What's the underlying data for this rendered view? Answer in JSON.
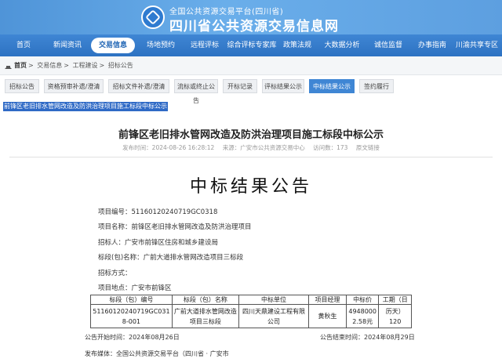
{
  "header": {
    "subtitle": "全国公共资源交易平台(四川省)",
    "title": "四川省公共资源交易信息网"
  },
  "nav": [
    {
      "label": "首页"
    },
    {
      "label": "新闻资讯"
    },
    {
      "label": "交易信息",
      "active": true
    },
    {
      "label": "场地预约"
    },
    {
      "label": "远程评标"
    },
    {
      "label": "综合评标专家库"
    },
    {
      "label": "政策法规"
    },
    {
      "label": "大数据分析"
    },
    {
      "label": "诚信监督"
    },
    {
      "label": "办事指南"
    },
    {
      "label": "川渝共享专区"
    }
  ],
  "breadcrumb": {
    "items": [
      "首页",
      "交易信息",
      "工程建设",
      "招标公告"
    ],
    "separator": ">"
  },
  "tabs": [
    {
      "label": "招标公告"
    },
    {
      "label": "资格预审补遗/澄清"
    },
    {
      "label": "招标文件补遗/澄清"
    },
    {
      "label": "流标或终止公告"
    },
    {
      "label": "开标记录"
    },
    {
      "label": "评标结果公示"
    },
    {
      "label": "中标结果公示",
      "active": true
    },
    {
      "label": "签约履行"
    }
  ],
  "selected_text": "前锋区老旧排水管网改造及防洪治理项目施工标段中标公示",
  "article": {
    "title": "前锋区老旧排水管网改造及防洪治理项目施工标段中标公示",
    "meta": {
      "publish_time": "发布时间：2024-08-26 16:28:12",
      "source": "来源：广安市公共资源交易中心",
      "views": "访问数：173",
      "print": "原文链接"
    },
    "heading": "中标结果公告",
    "fields": {
      "project_no": "项目编号：51160120240719GC0318",
      "project_name": "项目名称：前锋区老旧排水管网改造及防洪治理项目",
      "tenderer": "招标人：广安市前锋区住房和城乡建设局",
      "section": "标段(包)名称：广前大道排水管网改造项目三标段",
      "method": "招标方式：",
      "location": "项目地点：广安市前锋区"
    },
    "table": {
      "headers": [
        "标段（包）编号",
        "标段（包）名称",
        "中标单位",
        "项目经理",
        "中标价",
        "工期（日"
      ],
      "rows": [
        [
          "51160120240719GC0318-001",
          "广前大道排水管网改造项目三标段",
          "四川天鼎建设工程有限公司",
          "黄秋生",
          "49480002.58元",
          "历天）120"
        ]
      ]
    },
    "notice_start": "公告开始时间：2024年08月26日",
    "notice_end": "公告结束时间：2024年08月29日",
    "media": "发布媒体：全国公共资源交易平台（四川省 · 广安市"
  },
  "colors": {
    "header_blue": "#5d9fe0",
    "nav_blue": "#2d72c2",
    "active_tab": "#3f86d4",
    "selection": "#2f6ac6"
  }
}
